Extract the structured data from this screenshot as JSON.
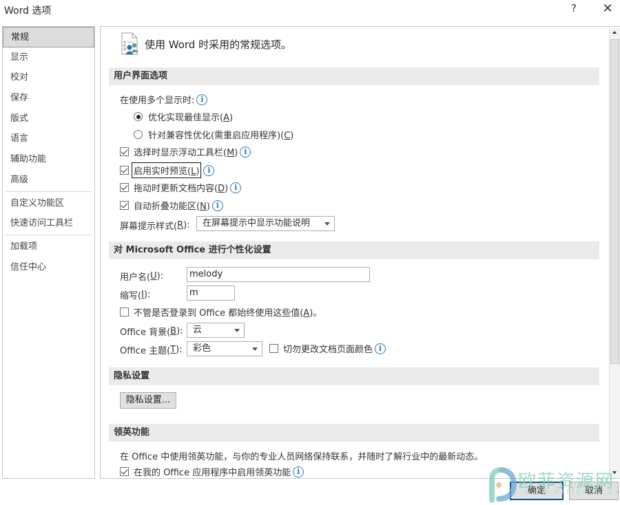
{
  "window": {
    "title": "Word 选项",
    "help_label": "?",
    "close_label": "✕"
  },
  "sidebar": {
    "items": [
      {
        "label": "常规",
        "active": true
      },
      {
        "label": "显示"
      },
      {
        "label": "校对"
      },
      {
        "label": "保存"
      },
      {
        "label": "版式"
      },
      {
        "label": "语言"
      },
      {
        "label": "辅助功能"
      },
      {
        "label": "高级"
      },
      {
        "label": "自定义功能区"
      },
      {
        "label": "快速访问工具栏"
      },
      {
        "label": "加载项"
      },
      {
        "label": "信任中心"
      }
    ]
  },
  "header": {
    "icon": "general-options-icon",
    "text": "使用 Word 时采用的常规选项。"
  },
  "ui_options": {
    "title": "用户界面选项",
    "multi_display_label": "在使用多个显示时:",
    "radio_best": {
      "text": "优化实现最佳显示(",
      "key": "A",
      "end": ")",
      "checked": true
    },
    "radio_compat": {
      "text": "针对兼容性优化(需重启应用程序)(",
      "key": "C",
      "end": ")",
      "checked": false
    },
    "mini_toolbar": {
      "text": "选择时显示浮动工具栏(",
      "key": "M",
      "end": ")",
      "checked": true
    },
    "live_preview": {
      "text": "启用实时预览(",
      "key": "L",
      "end": ")",
      "checked": true
    },
    "update_drag": {
      "text": "拖动时更新文档内容(",
      "key": "D",
      "end": ")",
      "checked": true
    },
    "collapse_ribbon": {
      "text": "自动折叠功能区(",
      "key": "N",
      "end": ")",
      "checked": true
    },
    "screentip_label": {
      "text": "屏幕提示样式(",
      "key": "R",
      "end": "):"
    },
    "screentip_value": "在屏幕提示中显示功能说明"
  },
  "personalize": {
    "title": "对 Microsoft Office 进行个性化设置",
    "username_label": {
      "text": "用户名(",
      "key": "U",
      "end": "):"
    },
    "username_value": "melody",
    "initials_label": {
      "text": "缩写(",
      "key": "I",
      "end": "):"
    },
    "initials_value": "m",
    "always_use": {
      "text": "不管是否登录到 Office 都始终使用这些值(",
      "key": "A",
      "end": ")。",
      "checked": false
    },
    "background_label": {
      "text": "Office 背景(",
      "key": "B",
      "end": "):"
    },
    "background_value": "云",
    "theme_label": {
      "text": "Office 主题(",
      "key": "T",
      "end": "):"
    },
    "theme_value": "彩色",
    "never_change_color": {
      "text": "切勿更改文档页面颜色",
      "checked": false
    }
  },
  "privacy": {
    "title": "隐私设置",
    "button_label": "隐私设置..."
  },
  "linkedin": {
    "title": "领英功能",
    "description": "在 Office 中使用领英功能，与你的专业人员网络保持联系，并随时了解行业中的最新动态。",
    "enable": {
      "text": "在我的 Office 应用程序中启用领英功能",
      "checked": true
    }
  },
  "footer": {
    "ok_label": "确定",
    "cancel_label": "取消"
  },
  "watermark": {
    "text": "欧菲资源网",
    "sub": "www.office26.com"
  },
  "colors": {
    "info_icon": "#2a7ab8",
    "section_bg": "#ebebeb",
    "sidebar_active_bg": "#dcdcdc",
    "primary_button_border": "#1a4f8a"
  }
}
